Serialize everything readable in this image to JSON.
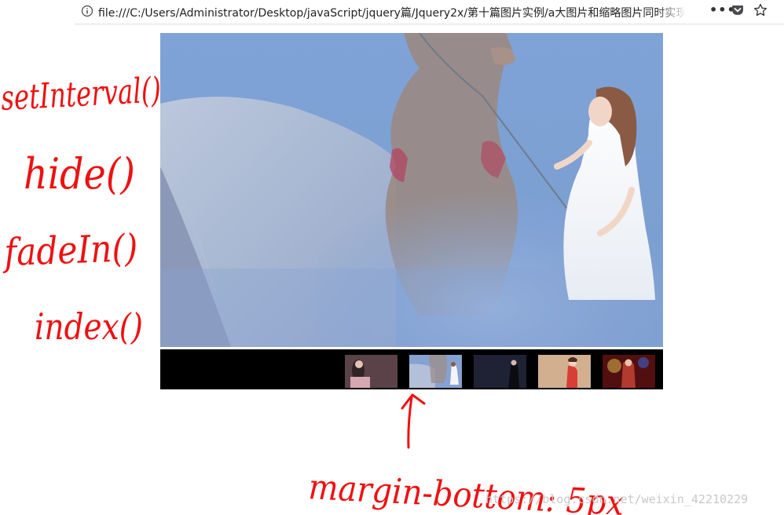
{
  "browser": {
    "url": "file:///C:/Users/Administrator/Desktop/javaScript/jquery篇/Jquery2x/第十篇图片实例/a大图片和缩略图片同时实现自",
    "icons": {
      "info": "info-icon",
      "more": "more-icon",
      "pocket": "pocket-icon",
      "bookmark": "star-icon"
    }
  },
  "slideshow": {
    "thumbnails": [
      {
        "name": "thumb-1",
        "palette": [
          "#5a4348",
          "#d7a8b2"
        ]
      },
      {
        "name": "thumb-2",
        "palette": [
          "#86a2d2",
          "#e9e2dc"
        ]
      },
      {
        "name": "thumb-3",
        "palette": [
          "#161827",
          "#2d2f4b"
        ]
      },
      {
        "name": "thumb-4",
        "palette": [
          "#c9a283",
          "#d93e36"
        ]
      },
      {
        "name": "thumb-5",
        "palette": [
          "#520f0f",
          "#d2ab49"
        ]
      }
    ]
  },
  "annotations": {
    "notes": [
      "setInterval()",
      "hide()",
      "fadeIn()",
      "index()"
    ],
    "arrow_note": "margin-bottom: 5px",
    "color": "#ee1111"
  },
  "watermark": "https://blog.csdn.net/weixin_42210229"
}
